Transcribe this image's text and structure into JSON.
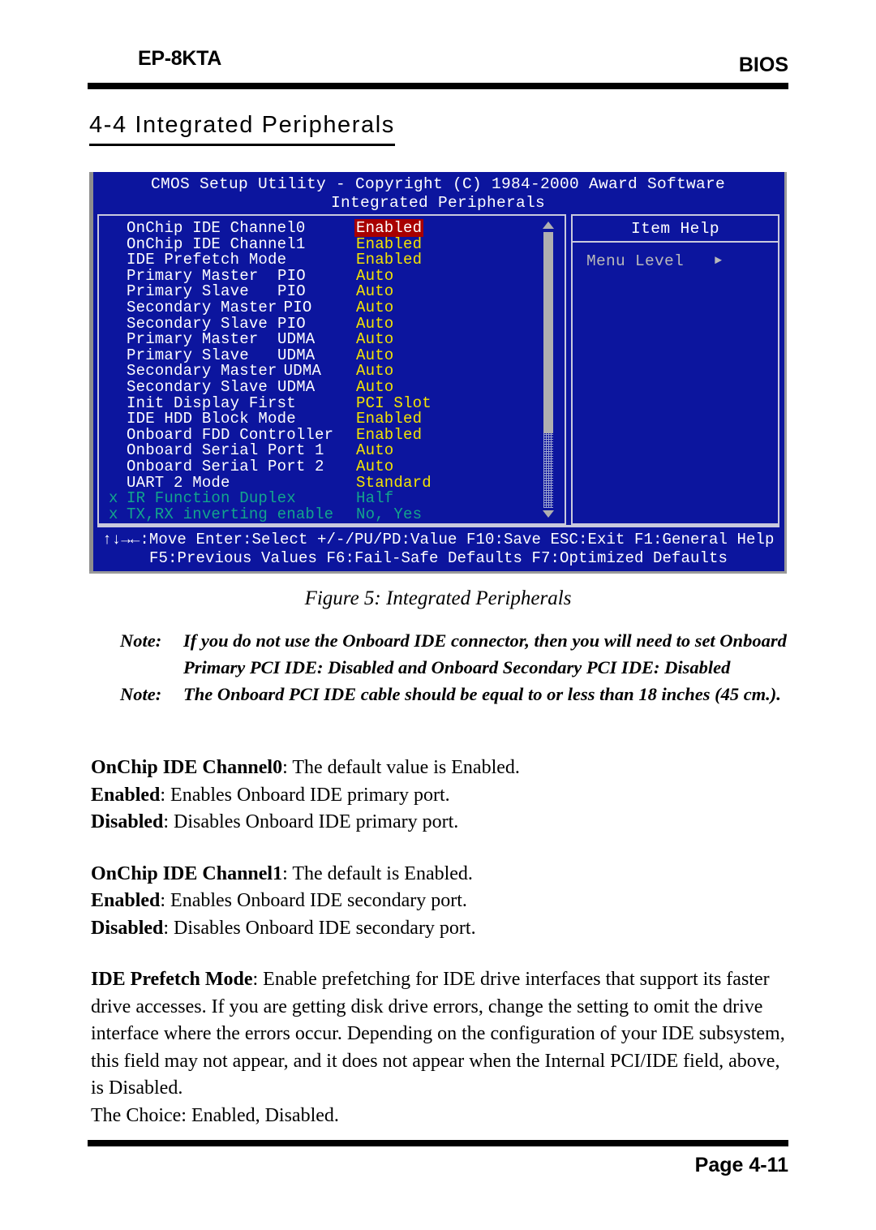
{
  "header": {
    "model": "EP-8KTA",
    "section": "BIOS"
  },
  "heading": "4-4 Integrated Peripherals",
  "bios": {
    "title_line1": "CMOS Setup Utility - Copyright (C) 1984-2000 Award Software",
    "title_line2": "Integrated Peripherals",
    "help_title": "Item Help",
    "help_menu_level": "Menu Level",
    "help_arrow": "►",
    "options": [
      {
        "prefix": "",
        "label": "OnChip IDE Channel0",
        "sub": "",
        "value": "Enabled",
        "state": "selected"
      },
      {
        "prefix": "",
        "label": "OnChip IDE Channel1",
        "sub": "",
        "value": "Enabled",
        "state": "normal"
      },
      {
        "prefix": "",
        "label": "IDE Prefetch Mode",
        "sub": "",
        "value": "Enabled",
        "state": "normal"
      },
      {
        "prefix": "",
        "label": "Primary Master",
        "sub": "PIO",
        "value": "Auto",
        "state": "normal"
      },
      {
        "prefix": "",
        "label": "Primary Slave",
        "sub": "PIO",
        "value": "Auto",
        "state": "normal"
      },
      {
        "prefix": "",
        "label": "Secondary Master",
        "sub": "PIO",
        "value": "Auto",
        "state": "normal"
      },
      {
        "prefix": "",
        "label": "Secondary Slave",
        "sub": "PIO",
        "value": "Auto",
        "state": "normal"
      },
      {
        "prefix": "",
        "label": "Primary Master",
        "sub": "UDMA",
        "value": "Auto",
        "state": "normal"
      },
      {
        "prefix": "",
        "label": "Primary Slave",
        "sub": "UDMA",
        "value": "Auto",
        "state": "normal"
      },
      {
        "prefix": "",
        "label": "Secondary Master",
        "sub": "UDMA",
        "value": "Auto",
        "state": "normal"
      },
      {
        "prefix": "",
        "label": "Secondary Slave",
        "sub": "UDMA",
        "value": "Auto",
        "state": "normal"
      },
      {
        "prefix": "",
        "label": "Init Display First",
        "sub": "",
        "value": "PCI Slot",
        "state": "normal"
      },
      {
        "prefix": "",
        "label": "IDE HDD Block Mode",
        "sub": "",
        "value": "Enabled",
        "state": "normal"
      },
      {
        "prefix": "",
        "label": "Onboard FDD Controller",
        "sub": "",
        "value": "Enabled",
        "state": "normal"
      },
      {
        "prefix": "",
        "label": "Onboard Serial Port 1",
        "sub": "",
        "value": "Auto",
        "state": "normal"
      },
      {
        "prefix": "",
        "label": "Onboard Serial Port 2",
        "sub": "",
        "value": "Auto",
        "state": "normal"
      },
      {
        "prefix": "",
        "label": "UART 2 Mode",
        "sub": "",
        "value": "Standard",
        "state": "normal"
      },
      {
        "prefix": "x",
        "label": "IR Function Duplex",
        "sub": "",
        "value": "Half",
        "state": "dim"
      },
      {
        "prefix": "x",
        "label": "TX,RX inverting enable",
        "sub": "",
        "value": "No, Yes",
        "state": "dim"
      }
    ],
    "keys_line1": "↑↓→←:Move  Enter:Select  +/-/PU/PD:Value  F10:Save  ESC:Exit  F1:General Help",
    "keys_line2": "F5:Previous Values    F6:Fail-Safe Defaults    F7:Optimized Defaults",
    "colors": {
      "background": "#0c159e",
      "label": "#ffffff",
      "value": "#f5e400",
      "dimmed": "#13a58c",
      "selected_bg": "#a80000",
      "border": "#c9c9dd",
      "scrollbar": "#b0b0b0"
    }
  },
  "figure_caption": "Figure 5:  Integrated Peripherals",
  "notes": [
    {
      "tag": "Note:",
      "text": "If you do not use the Onboard IDE connector, then you will need to set Onboard Primary PCI IDE: Disabled and Onboard Secondary PCI IDE: Disabled"
    },
    {
      "tag": "Note:",
      "text": "The Onboard PCI IDE cable should be equal to or less than 18 inches (45 cm.)."
    }
  ],
  "body": {
    "ch0_term": "OnChip IDE Channel0",
    "ch0_desc": ": The default value is Enabled.",
    "ch0_enabled_term": "Enabled",
    "ch0_enabled_desc": ":  Enables Onboard IDE primary port.",
    "ch0_disabled_term": "Disabled",
    "ch0_disabled_desc": ": Disables Onboard IDE primary port.",
    "ch1_term": "OnChip IDE Channel1",
    "ch1_desc": ": The default is Enabled.",
    "ch1_enabled_term": "Enabled",
    "ch1_enabled_desc": ":  Enables Onboard IDE secondary port.",
    "ch1_disabled_term": "Disabled",
    "ch1_disabled_desc": ": Disables Onboard IDE secondary port.",
    "prefetch_term": "IDE Prefetch Mode",
    "prefetch_desc": ":  Enable prefetching for IDE drive interfaces that support its faster drive accesses.  If you are getting disk drive errors, change the setting to omit the drive interface where the errors occur. Depending on the configuration of your IDE subsystem, this field may not appear, and it does not appear when the Internal PCI/IDE field, above, is Disabled.",
    "prefetch_choice": "The Choice: Enabled, Disabled."
  },
  "page_number": "Page 4-11"
}
